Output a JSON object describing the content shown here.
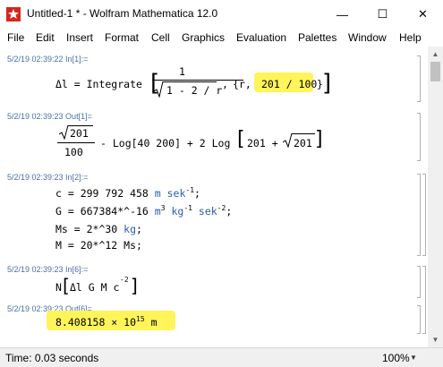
{
  "window": {
    "title": "Untitled-1 * - Wolfram Mathematica 12.0",
    "minimize_glyph": "—",
    "maximize_glyph": "☐",
    "close_glyph": "✕"
  },
  "menu": [
    "File",
    "Edit",
    "Insert",
    "Format",
    "Cell",
    "Graphics",
    "Evaluation",
    "Palettes",
    "Window",
    "Help"
  ],
  "cells": {
    "in1_label": "5/2/19 02:39:22 In[1]:=",
    "in1": {
      "lhs": "Δl = Integrate",
      "numerator": "1",
      "denominator_radicand": "1 - 2 / r",
      "range_open": "{r, 2, ",
      "range_upper": "201 / 100",
      "range_close": "}"
    },
    "out1_label": "5/2/19 02:39:23 Out[1]=",
    "out1": {
      "frac_num_radicand": "201",
      "frac_den": "100",
      "term2": "- Log[40 200] + 2 Log",
      "term3_a": "201 + ",
      "term3_radicand": "201"
    },
    "in2_label": "5/2/19 02:39:23 In[2]:=",
    "in2_lines": [
      {
        "lhs": "c = 299 792 458 ",
        "unit": "m sek",
        "exp": "-1",
        "tail": ";"
      },
      {
        "lhs": "G = 667384*^-16 ",
        "unit": "m",
        "exp": "3",
        "unit2": " kg",
        "exp2": "-1",
        "unit3": " sek",
        "exp3": "-2",
        "tail": ";"
      },
      {
        "lhs": "Ms = 2*^30 ",
        "unit": "kg",
        "tail": ";"
      },
      {
        "lhs": "M = 20*^12 Ms;"
      }
    ],
    "in6_label": "5/2/19 02:39:23 In[6]:=",
    "in6": {
      "head": "N",
      "body": "Δl G M c",
      "exp": "-2"
    },
    "out6_label": "5/2/19 02:39:23 Out[6]=",
    "out6": {
      "mantissa": "8.408158 × 10",
      "exp": "15",
      "unit": " m"
    }
  },
  "status": {
    "time": "Time: 0.03 seconds",
    "zoom": "100%"
  },
  "colors": {
    "highlight": "#fff45a",
    "label": "#4a6fa5",
    "symbol_blue": "#2a5cb0",
    "icon_red": "#d5261e"
  }
}
